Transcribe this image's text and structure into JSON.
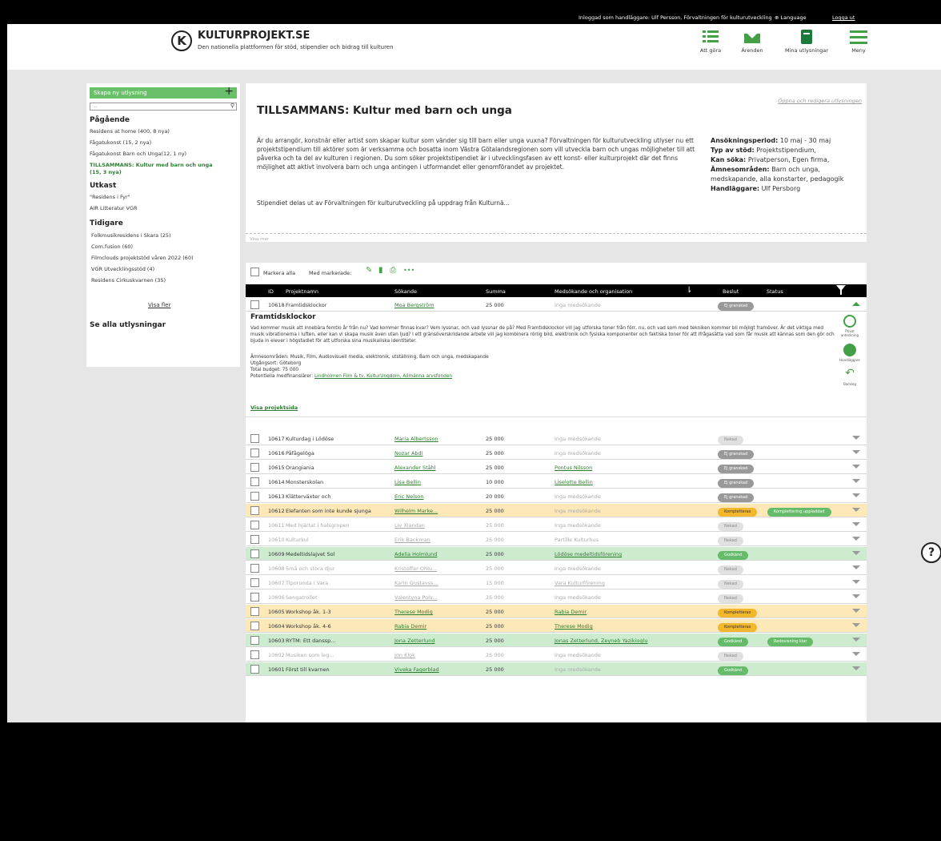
{
  "topbar": {
    "logged_in": "Inloggad som handläggare: Ulf Persson, Förvaltningen för kulturutveckling",
    "language": "Language",
    "logout": "Logga ut"
  },
  "header": {
    "logo_letter": "K",
    "brand": "KULTURPROJEKT.SE",
    "tagline": "Den nationella plattformen för stöd, stipendier och bidrag till kulturen",
    "nav": [
      {
        "label": "Att göra",
        "icon": "list-icon"
      },
      {
        "label": "Ärenden",
        "icon": "inbox-icon"
      },
      {
        "label": "Mina utlysningar",
        "icon": "book-icon"
      },
      {
        "label": "Meny",
        "icon": "hamburger-icon"
      }
    ]
  },
  "sidebar": {
    "create_label": "Skapa ny utlysning",
    "search_placeholder": "...",
    "sections": {
      "ongoing": "Pågående",
      "drafts": "Utkast",
      "previous": "Tidigare"
    },
    "ongoing_items": [
      "Residens at home (400, 8 nya)",
      "Fågatukonst (15, 2 nya)",
      "Fågatukonst Barn och Unga(12, 1 ny)",
      "TILLSAMMANS: Kultur med barn och unga",
      "(15, 3 nya)"
    ],
    "draft_items": [
      "\"Residens i Fyr\"",
      "AIR Litteratur VGR"
    ],
    "previous_items": [
      "Folkmusikresidens i Skara (25)",
      "Com.fusion (60)",
      "Filmclouds projektstöd våren 2022 (60)",
      "VGR Utvecklingsstöd (4)",
      "Residens Cirkuskvarnen (35)"
    ],
    "show_more": "Visa fler",
    "see_all": "Se alla utlysningar"
  },
  "call": {
    "title": "TILLSAMMANS: Kultur med barn och unga",
    "edit_link": "Öppna och redigera utlysningen",
    "description": "Är du arrangör, konstnär eller artist som skapar kultur som vänder sig till barn eller unga vuxna? Förvaltningen för kulturutveckling utlyser nu ett projektstipendium till aktörer som är verksamma och bosatta inom Västra Götalandsregionen som vill utveckla barn och ungas möjligheter till att påverka och ta del av kulturen i regionen. Du som söker projektstipendiet är i utvecklingsfasen av ett konst- eller kulturprojekt där det finns möjlighet att aktivt involvera barn och unga antingen i utformandet eller genomförandet av projektet.",
    "description2": "Stipendiet delas ut av Förvaltningen för kulturutveckling på uppdrag från Kulturnä...",
    "meta": [
      {
        "label": "Ansökningsperiod:",
        "value": "10 maj - 30 maj"
      },
      {
        "label": "Typ av stöd:",
        "value": "Projektstipendium,"
      },
      {
        "label": "Kan söka:",
        "value": "Privatperson, Egen firma,"
      },
      {
        "label": "Ämnesområden:",
        "value": "Barn och unga, medskapande, alla konstarter, pedagogik"
      },
      {
        "label": "Handläggare:",
        "value": "Ulf Persborg"
      }
    ],
    "show_more": "Visa mer"
  },
  "bulk": {
    "select_all": "Markera alla",
    "with_selected": "Med markerade:",
    "more": "•••"
  },
  "table": {
    "headers": {
      "id": "ID",
      "name": "Projektnamn",
      "applicant": "Sökande",
      "sum": "Summa",
      "co": "Medsökande och organisation",
      "decision": "Beslut",
      "status": "Status"
    },
    "expanded_row": {
      "id": "10618",
      "name": "Framtidsklockor",
      "applicant": "Moa Bergström",
      "sum": "25 000",
      "co": "Inga medsökande",
      "decision": "Ej granskad"
    },
    "detail": {
      "title": "Framtidsklockor",
      "text": "Vad kommer musik att innebära femtio år från nu? Vad kommer finnas kvar? Vem lyssnar, och vad lyssnar de på? Med Framtidsklockor vill jag utforska toner från förr, nu, och vad som med tekniken kommer bli möjligt framöver. Är det viktiga med musik vibrationerna i luften, eller kan vi skapa musik även utan ljud? I ett gränsöverskridande arbete vill jag kombinera rörlig bild, elektronik och fysiska komponenter och faktiska toner för att ifrågasätta vad som får musik att kännas som den gör och bjuda in elever i högstadiet för att utforska sina musikaliska identiteter.",
      "areas": "Ämnesområden: Musik, Film, Audiovisuell media, elektronik, utställning, Barn och unga, medskapande",
      "location": "Utgångsort: Göteborg",
      "budget": "Total budget: 75 000",
      "cofunders_label": "Potentiella medfinansiärer:",
      "cofunders": "Lindholmen Film & tv, KulturUngdom, Allmänna arvsfonden",
      "project_link": "Visa projektsida",
      "actions": [
        "Privat anteckning",
        "Handläggare",
        "Backlog"
      ]
    },
    "rows": [
      {
        "id": "10617",
        "name": "Kulturdag i Lödöse",
        "applicant": "Maria Albertsson",
        "sum": "25 000",
        "co": "Inga medsökande",
        "co_link": false,
        "decision": "Nekad",
        "dstyle": "light",
        "status": "",
        "row": "white"
      },
      {
        "id": "10616",
        "name": "Påfågelöga",
        "applicant": "Nozar Abdi",
        "sum": "25 000",
        "co": "Inga medsökande",
        "co_link": false,
        "decision": "Ej granskad",
        "dstyle": "grey",
        "status": "",
        "row": "white"
      },
      {
        "id": "10615",
        "name": "Orangiania",
        "applicant": "Alexander Ståhl",
        "sum": "25 000",
        "co": "Pontus Nilsson",
        "co_link": true,
        "decision": "Ej granskad",
        "dstyle": "grey",
        "status": "",
        "row": "white"
      },
      {
        "id": "10614",
        "name": "Monsterskolan",
        "applicant": "Lisa Bellin",
        "sum": "10 000",
        "co": "Liselotte Bellin",
        "co_link": true,
        "decision": "Ej granskad",
        "dstyle": "grey",
        "status": "",
        "row": "white"
      },
      {
        "id": "10613",
        "name": "Klätterväxter och",
        "applicant": "Eric Nelson",
        "sum": "20 000",
        "co": "Inga medsökande",
        "co_link": false,
        "decision": "Ej granskad",
        "dstyle": "grey",
        "status": "",
        "row": "white"
      },
      {
        "id": "10612",
        "name": "Elefanten som inte kunde sjunga",
        "applicant": "Wilhelm Marke...",
        "sum": "25 000",
        "co": "Inga medsökande",
        "co_link": false,
        "decision": "Kompletteras",
        "dstyle": "yellow",
        "status": "Komplettering uppladdad",
        "row": "yellow"
      },
      {
        "id": "10611",
        "name": "Med hjärtat i halsgropen",
        "applicant": "Liv Xiandan",
        "sum": "25 000",
        "co": "Inga medsökande",
        "co_link": false,
        "decision": "Nekad",
        "dstyle": "light",
        "status": "",
        "row": "faded"
      },
      {
        "id": "10610",
        "name": "Kulturkul",
        "applicant": "Erik Backman",
        "sum": "25 000",
        "co": "Partille Kulturhus",
        "co_link": false,
        "decision": "Nekad",
        "dstyle": "light",
        "status": "",
        "row": "faded"
      },
      {
        "id": "10609",
        "name": "Medeltidslajvet Sol",
        "applicant": "Adelia Holmlund",
        "sum": "25 000",
        "co": "Lödöse medeltidsförening",
        "co_link": true,
        "decision": "Godkänd",
        "dstyle": "green",
        "status": "",
        "row": "green"
      },
      {
        "id": "10608",
        "name": "Små och stora djur",
        "applicant": "Kristoffer Ohlu...",
        "sum": "25 000",
        "co": "Inga medsökande",
        "co_link": false,
        "decision": "Nekad",
        "dstyle": "light",
        "status": "",
        "row": "faded"
      },
      {
        "id": "10607",
        "name": "Tiporunda i Vara",
        "applicant": "Karin Gustavss...",
        "sum": "15 000",
        "co": "Vara Kulturförening",
        "co_link": true,
        "decision": "Nekad",
        "dstyle": "light",
        "status": "",
        "row": "faded"
      },
      {
        "id": "10606",
        "name": "Sengatrollet",
        "applicant": "Valentyna Polv...",
        "sum": "25 000",
        "co": "Inga medsökande",
        "co_link": false,
        "decision": "Nekad",
        "dstyle": "light",
        "status": "",
        "row": "faded"
      },
      {
        "id": "10605",
        "name": "Workshop åk. 1-3",
        "applicant": "Therese Modig",
        "sum": "25 000",
        "co": "Rabia Demir",
        "co_link": true,
        "decision": "Kompletteras",
        "dstyle": "yellow",
        "status": "",
        "row": "yellow"
      },
      {
        "id": "10604",
        "name": "Workshop åk. 4-6",
        "applicant": "Rabia Demir",
        "sum": "25 000",
        "co": "Therese Modig",
        "co_link": true,
        "decision": "Kompletteras",
        "dstyle": "yellow",
        "status": "",
        "row": "yellow"
      },
      {
        "id": "10603",
        "name": "RYTM: Ett danssp...",
        "applicant": "Jona Zetterlund",
        "sum": "25 000",
        "co": "Jonas Zetterlund, Zeyneb Yazikioglu",
        "co_link": true,
        "decision": "Godkänd",
        "dstyle": "green",
        "status": "Redovisning klar",
        "row": "green"
      },
      {
        "id": "10602",
        "name": "Musiken som leg...",
        "applicant": "Jon Klok",
        "sum": "25 000",
        "co": "Inga medsökande",
        "co_link": false,
        "decision": "Nekad",
        "dstyle": "light",
        "status": "",
        "row": "faded"
      },
      {
        "id": "10601",
        "name": "Först till kvarnen",
        "applicant": "Viveka Fagerblad",
        "sum": "25 000",
        "co": "Inga medsökande",
        "co_link": false,
        "decision": "Godkänd",
        "dstyle": "green",
        "status": "",
        "row": "green"
      }
    ]
  },
  "help": "?",
  "colors": {
    "accent_green": "#43a047",
    "row_yellow": "#fde8b8",
    "row_green": "#cdeccf",
    "badge_yellow": "#f3b72e",
    "badge_green": "#66bb6a"
  }
}
